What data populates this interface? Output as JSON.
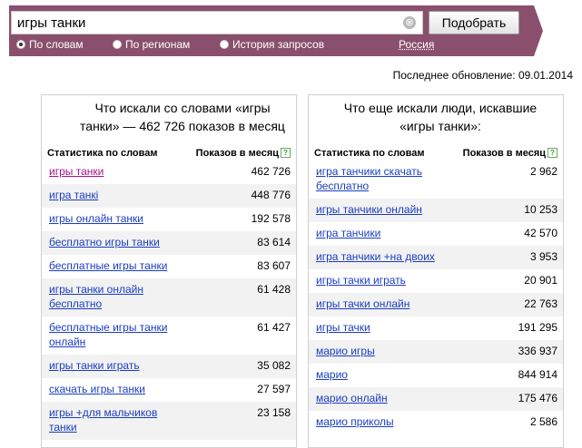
{
  "search": {
    "query": "игры танки",
    "clear_glyph": "⊗",
    "button_label": "Подобрать"
  },
  "modes": [
    {
      "label": "По словам",
      "selected": true
    },
    {
      "label": "По регионам",
      "selected": false
    },
    {
      "label": "История запросов",
      "selected": false
    }
  ],
  "region": "Россия",
  "updated": "Последнее обновление: 09.01.2014",
  "left": {
    "title": "Что искали со словами «игры танки» — 462 726 показов в месяц",
    "col_words": "Статистика по словам",
    "col_shows": "Показов в месяц",
    "rows": [
      {
        "q": "игры танки",
        "n": "462 726"
      },
      {
        "q": "игра танкі",
        "n": "448 776"
      },
      {
        "q": "игры онлайн танки",
        "n": "192 578"
      },
      {
        "q": "бесплатно игры танки",
        "n": "83 614"
      },
      {
        "q": "бесплатные игры танки",
        "n": "83 607"
      },
      {
        "q": "игры танки онлайн бесплатно",
        "n": "61 428"
      },
      {
        "q": "бесплатные игры танки онлайн",
        "n": "61 427"
      },
      {
        "q": "игры танки играть",
        "n": "35 082"
      },
      {
        "q": "скачать игры танки",
        "n": "27 597"
      },
      {
        "q": "игры +для мальчиков танки",
        "n": "23 158"
      }
    ]
  },
  "right": {
    "title": "Что еще искали люди, искавшие «игры танки»:",
    "col_words": "Статистика по словам",
    "col_shows": "Показов в месяц",
    "rows": [
      {
        "q": "игра танчики скачать бесплатно",
        "n": "2 962"
      },
      {
        "q": "игры танчики онлайн",
        "n": "10 253"
      },
      {
        "q": "игра танчики",
        "n": "42 570"
      },
      {
        "q": "игра танчики +на двоих",
        "n": "3 953"
      },
      {
        "q": "игры тачки играть",
        "n": "20 901"
      },
      {
        "q": "игры тачки онлайн",
        "n": "22 763"
      },
      {
        "q": "игры тачки",
        "n": "191 295"
      },
      {
        "q": "марио игры",
        "n": "336 937"
      },
      {
        "q": "марио",
        "n": "844 914"
      },
      {
        "q": "марио онлайн",
        "n": "175 476"
      },
      {
        "q": "марио приколы",
        "n": "2 586"
      }
    ]
  }
}
